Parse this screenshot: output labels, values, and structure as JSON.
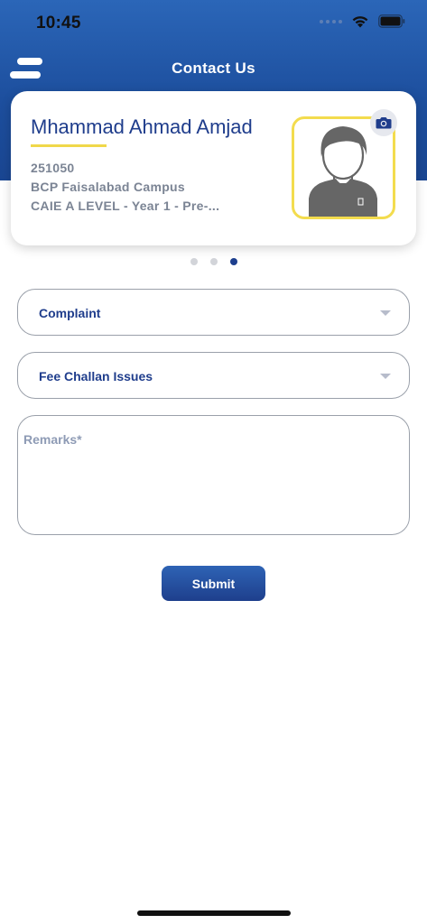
{
  "status_bar": {
    "time": "10:45"
  },
  "header": {
    "title": "Contact Us"
  },
  "profile": {
    "name": "Mhammad Ahmad Amjad",
    "id": "251050",
    "campus": "BCP Faisalabad Campus",
    "program": "CAIE A LEVEL - Year 1 - Pre-..."
  },
  "pager": {
    "count": 3,
    "active_index": 2
  },
  "form": {
    "category_value": "Complaint",
    "subcategory_value": "Fee Challan Issues",
    "remarks_placeholder": "Remarks*",
    "remarks_value": "",
    "submit_label": "Submit"
  },
  "icons": {
    "menu": "menu-icon",
    "camera": "camera-icon",
    "avatar": "user-avatar-icon",
    "wifi": "wifi-icon",
    "battery": "battery-icon",
    "caret": "chevron-down-icon"
  },
  "colors": {
    "brand_blue": "#1f3d8c",
    "header_top": "#2b66b8",
    "accent_yellow": "#f3dc4e",
    "muted_text": "#7b8494"
  }
}
